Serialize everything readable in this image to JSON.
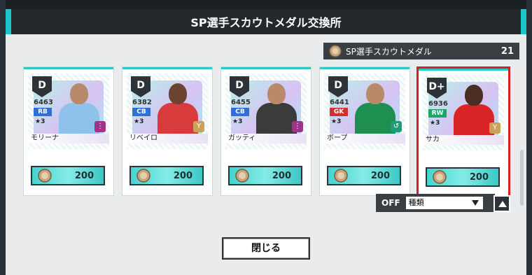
{
  "window": {
    "title": "SP選手スカウトメダル交換所"
  },
  "medal": {
    "label": "SP選手スカウトメダル",
    "count": "21"
  },
  "cards": [
    {
      "name": "モリーナ",
      "rank": "D",
      "ovr": "6463",
      "position": "RB",
      "stars": "★3",
      "cost": "200",
      "kit": "#8fc2ea",
      "selected": false
    },
    {
      "name": "リベイロ",
      "rank": "D",
      "ovr": "6382",
      "position": "CB",
      "stars": "★3",
      "cost": "200",
      "kit": "#d83b3b",
      "selected": false
    },
    {
      "name": "ガッティ",
      "rank": "D",
      "ovr": "6455",
      "position": "CB",
      "stars": "★3",
      "cost": "200",
      "kit": "#3b3b3b",
      "selected": false
    },
    {
      "name": "ボープ",
      "rank": "D",
      "ovr": "6441",
      "position": "GK",
      "stars": "★3",
      "cost": "200",
      "kit": "#1e8f4e",
      "selected": false
    },
    {
      "name": "サカ",
      "rank": "D+",
      "ovr": "6936",
      "position": "RW",
      "stars": "★3",
      "cost": "200",
      "kit": "#d82424",
      "selected": true
    }
  ],
  "filter": {
    "toggle": "OFF",
    "sort": "種類"
  },
  "buttons": {
    "close": "閉じる"
  },
  "colors": {
    "accent": "#1ec7c7",
    "selection": "#d71f1f"
  }
}
